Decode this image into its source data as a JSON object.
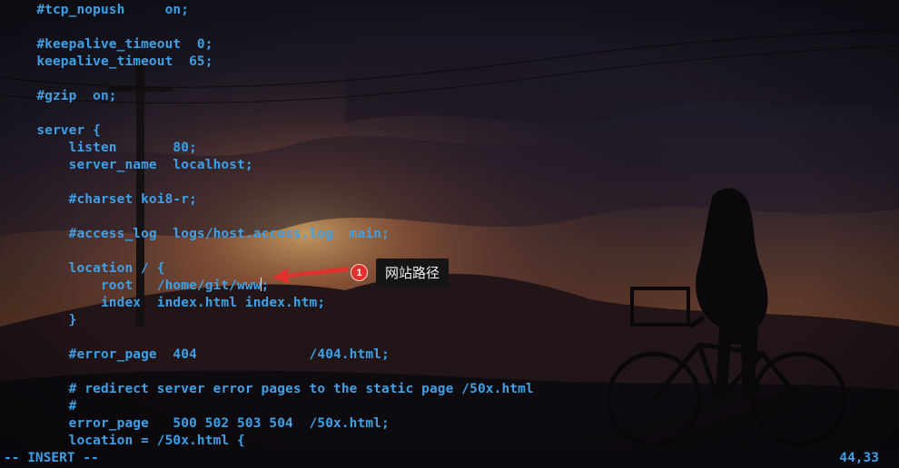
{
  "editor": {
    "lines": [
      "    #tcp_nopush     on;",
      "",
      "    #keepalive_timeout  0;",
      "    keepalive_timeout  65;",
      "",
      "    #gzip  on;",
      "",
      "    server {",
      "        listen       80;",
      "        server_name  localhost;",
      "",
      "        #charset koi8-r;",
      "",
      "        #access_log  logs/host.access.log  main;",
      "",
      "        location / {",
      "            root   /home/git/www",
      "            index  index.html index.htm;",
      "        }",
      "",
      "        #error_page  404              /404.html;",
      "",
      "        # redirect server error pages to the static page /50x.html",
      "        #",
      "        error_page   500 502 503 504  /50x.html;",
      "        location = /50x.html {"
    ],
    "cursor_line_suffix": ";"
  },
  "status": {
    "mode": "-- INSERT --",
    "position": "44,33"
  },
  "annotation": {
    "badge": "1",
    "label": "网站路径"
  },
  "colors": {
    "code_text": "#3ea0e6",
    "badge": "#e0312d",
    "arrow": "#e0312d",
    "tooltip_bg": "#151515"
  },
  "icons": {
    "arrow": "red-arrow-icon"
  }
}
